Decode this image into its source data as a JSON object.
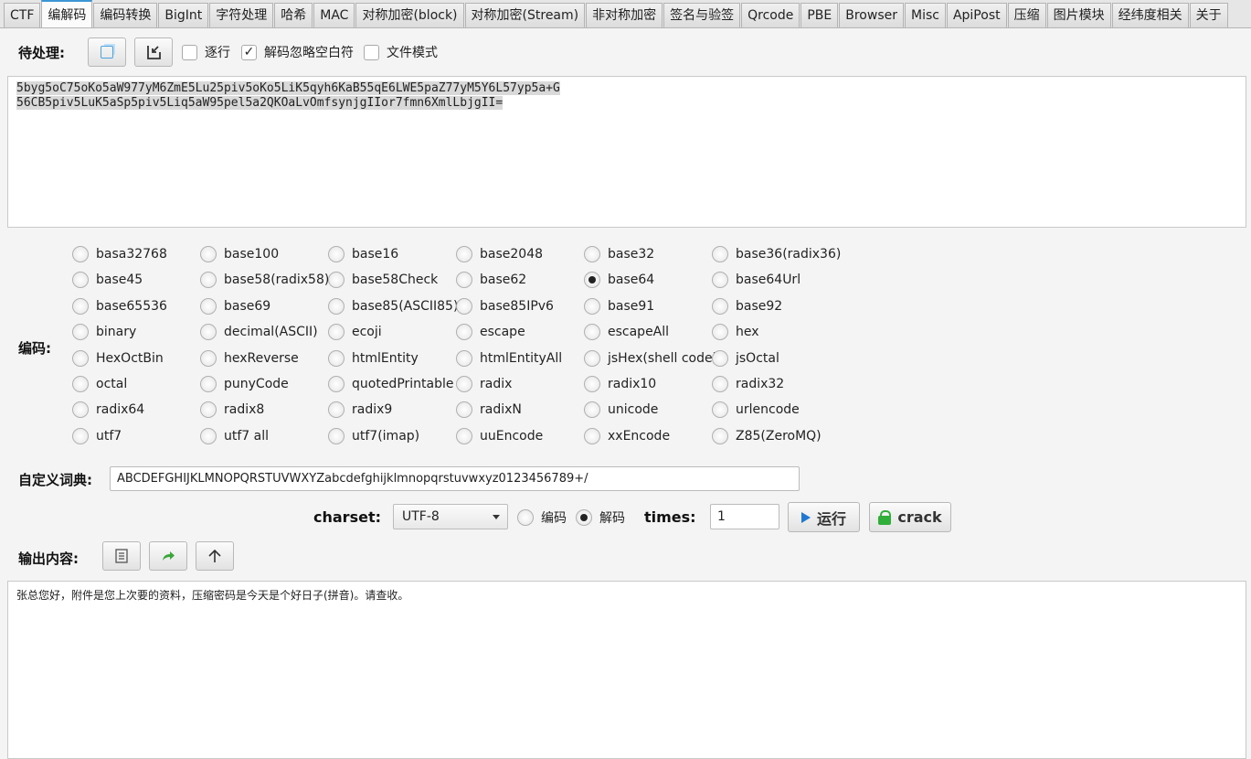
{
  "tabs": [
    "CTF",
    "编解码",
    "编码转换",
    "BigInt",
    "字符处理",
    "哈希",
    "MAC",
    "对称加密(block)",
    "对称加密(Stream)",
    "非对称加密",
    "签名与验签",
    "Qrcode",
    "PBE",
    "Browser",
    "Misc",
    "ApiPost",
    "压缩",
    "图片模块",
    "经纬度相关",
    "关于"
  ],
  "active_tab": "编解码",
  "input": {
    "label": "待处理:",
    "per_line_label": "逐行",
    "ignore_ws_label": "解码忽略空白符",
    "file_mode_label": "文件模式",
    "ignore_ws_checked": "✓",
    "text_line1": "5byg5oC75oKo5aW977yM6ZmE5Lu25piv5oKo5LiK5qyh6KaB55qE6LWE5paZ77yM5Y6L57yp5a+G",
    "text_line2": "56CB5piv5LuK5aSp5piv5Liq5aW95pel5a2QKOaLvOmfsynjgIIor7fmn6XmlLbjgII="
  },
  "encoding": {
    "label": "编码:",
    "selected": "base64",
    "options": [
      [
        "basa32768",
        "base100",
        "base16",
        "base2048",
        "base32",
        "base36(radix36)"
      ],
      [
        "base45",
        "base58(radix58)",
        "base58Check",
        "base62",
        "base64",
        "base64Url"
      ],
      [
        "base65536",
        "base69",
        "base85(ASCII85)",
        "base85IPv6",
        "base91",
        "base92"
      ],
      [
        "binary",
        "decimal(ASCII)",
        "ecoji",
        "escape",
        "escapeAll",
        "hex"
      ],
      [
        "HexOctBin",
        "hexReverse",
        "htmlEntity",
        "htmlEntityAll",
        "jsHex(shell code)",
        "jsOctal"
      ],
      [
        "octal",
        "punyCode",
        "quotedPrintable",
        "radix",
        "radix10",
        "radix32"
      ],
      [
        "radix64",
        "radix8",
        "radix9",
        "radixN",
        "unicode",
        "urlencode"
      ],
      [
        "utf7",
        "utf7 all",
        "utf7(imap)",
        "uuEncode",
        "xxEncode",
        "Z85(ZeroMQ)"
      ]
    ]
  },
  "dict": {
    "label": "自定义词典:",
    "value": "ABCDEFGHIJKLMNOPQRSTUVWXYZabcdefghijklmnopqrstuvwxyz0123456789+/"
  },
  "controls": {
    "charset_label": "charset:",
    "charset_value": "UTF-8",
    "encode_label": "编码",
    "decode_label": "解码",
    "mode_selected": "decode",
    "times_label": "times:",
    "times_value": "1",
    "run_label": "运行",
    "crack_label": "crack"
  },
  "output": {
    "label": "输出内容:",
    "text": "张总您好，附件是您上次要的资料，压缩密码是今天是个好日子(拼音)。请查收。"
  },
  "colors": {
    "accent": "#3c96d6",
    "play": "#1f78d1",
    "crack_icon": "#2fae3a",
    "share_icon": "#3aa63a",
    "selection": "#d9d9d9"
  }
}
